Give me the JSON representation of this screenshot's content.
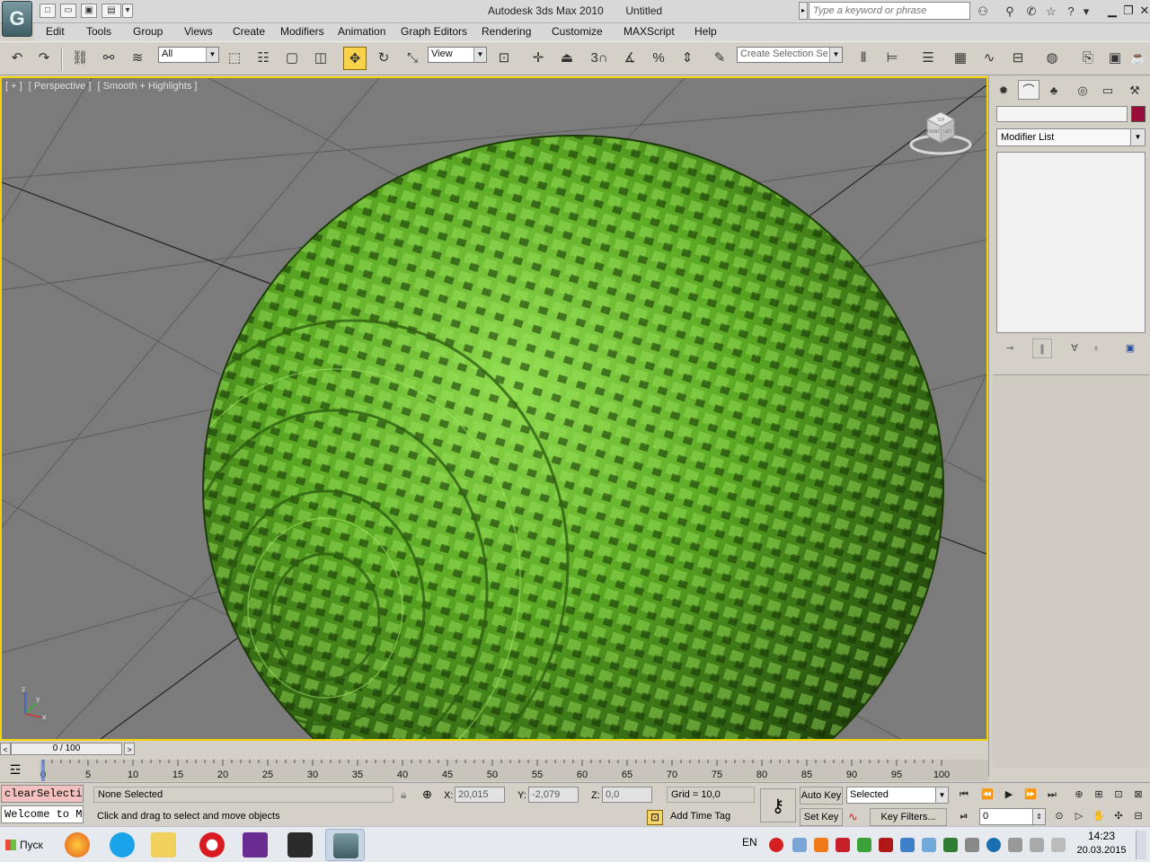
{
  "window": {
    "app_title": "Autodesk 3ds Max  2010",
    "document_title": "Untitled",
    "search_placeholder": "Type a keyword or phrase",
    "logo_glyph": "G"
  },
  "menu": [
    "Edit",
    "Tools",
    "Group",
    "Views",
    "Create",
    "Modifiers",
    "Animation",
    "Graph Editors",
    "Rendering",
    "Customize",
    "MAXScript",
    "Help"
  ],
  "toolbar": {
    "selection_filter": "All",
    "ref_coord_system": "View",
    "selection_set_placeholder": "Create Selection Se",
    "snap_label": "3"
  },
  "viewport": {
    "labels": [
      "[ + ]",
      "[ Perspective ]",
      "[ Smooth + Highlights ]"
    ],
    "viewcube_faces": [
      "TOP",
      "FRONT",
      "LEFT"
    ],
    "background_color": "#7b7b7b",
    "border_color": "#f5d300",
    "object_color": "#5aa823",
    "axes": [
      "x",
      "y",
      "z"
    ]
  },
  "command_panel": {
    "modifier_list": "Modifier List",
    "object_color": "#9a0f3a"
  },
  "timeline": {
    "slider_label": "0 / 100",
    "tick_labels": [
      "0",
      "5",
      "10",
      "15",
      "20",
      "25",
      "30",
      "35",
      "40",
      "45",
      "50",
      "55",
      "60",
      "65",
      "70",
      "75",
      "80",
      "85",
      "90",
      "95",
      "100"
    ]
  },
  "status": {
    "listener_line1": "clearSelectio",
    "listener_line2": "Welcome to M",
    "selection_info": "None Selected",
    "prompt": "Click and drag to select and move objects",
    "x_label": "X:",
    "x_value": "20,015",
    "y_label": "Y:",
    "y_value": "-2,079",
    "z_label": "Z:",
    "z_value": "0,0",
    "grid": "Grid = 10,0",
    "add_time_tag": "Add Time Tag",
    "auto_key": "Auto Key",
    "set_key": "Set Key",
    "selected_dropdown": "Selected",
    "key_filters": "Key Filters...",
    "frame": "0"
  },
  "taskbar": {
    "start": "Пуск",
    "language": "EN",
    "time": "14:23",
    "date": "20.03.2015"
  }
}
